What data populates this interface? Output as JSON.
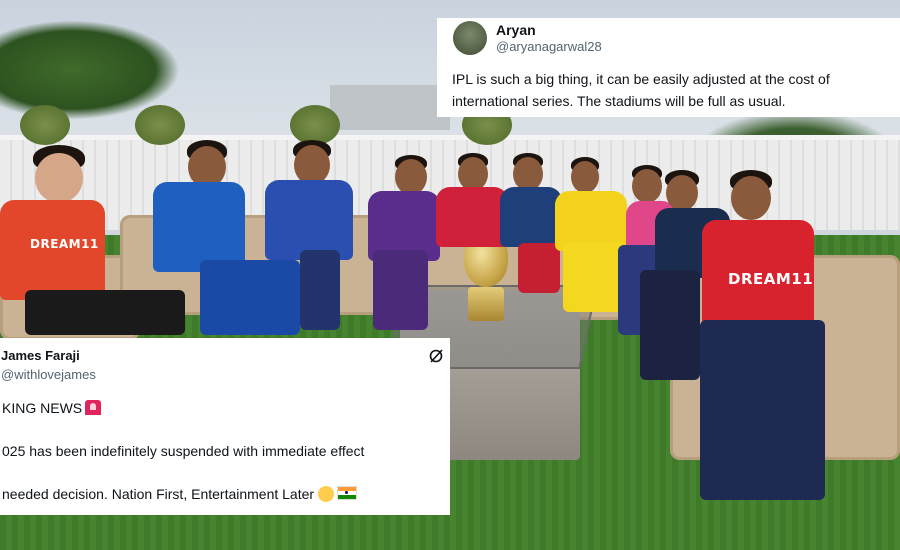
{
  "tweet_top": {
    "name": "Aryan",
    "handle": "@aryanagarwal28",
    "text": "IPL is such a big thing, it can be easily adjusted at the cost of international series. The stadiums will be full as usual."
  },
  "tweet_bottom": {
    "name": "James Faraji",
    "handle": "@withlovejames",
    "line1": "KING NEWS",
    "line2": "025 has been indefinitely suspended with immediate effect",
    "line3": "needed decision. Nation First, Entertainment Later"
  },
  "jerseys": {
    "srh": "DREAM11",
    "mi": "DREAM11",
    "pbks": "DREAM11"
  },
  "colors": {
    "srh": "#e2462b",
    "mi": "#1f5fbf",
    "dc": "#2b4fb0",
    "kkr": "#5a2d8c",
    "rcb": "#d1213a",
    "lsg": "#1e3f7a",
    "csk": "#f2d21b",
    "rr": "#e0468a",
    "gt": "#1b2d4f",
    "pbks": "#d8232f"
  }
}
